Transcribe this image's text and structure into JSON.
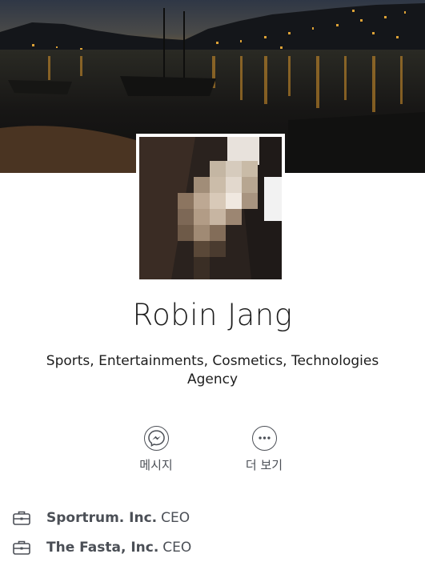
{
  "profile": {
    "name": "Robin Jang",
    "bio": "Sports, Entertainments, Cosmetics, Technologies Agency"
  },
  "actions": [
    {
      "label": "메시지",
      "icon": "messenger-icon"
    },
    {
      "label": "더 보기",
      "icon": "more-icon"
    }
  ],
  "work": [
    {
      "company": "Sportrum. Inc.",
      "role": "CEO",
      "icon": "briefcase-icon"
    },
    {
      "company": "The Fasta, Inc.",
      "role": "CEO",
      "icon": "briefcase-icon"
    }
  ],
  "colors": {
    "icon": "#4b4f56",
    "text": "#1d1d1d"
  }
}
